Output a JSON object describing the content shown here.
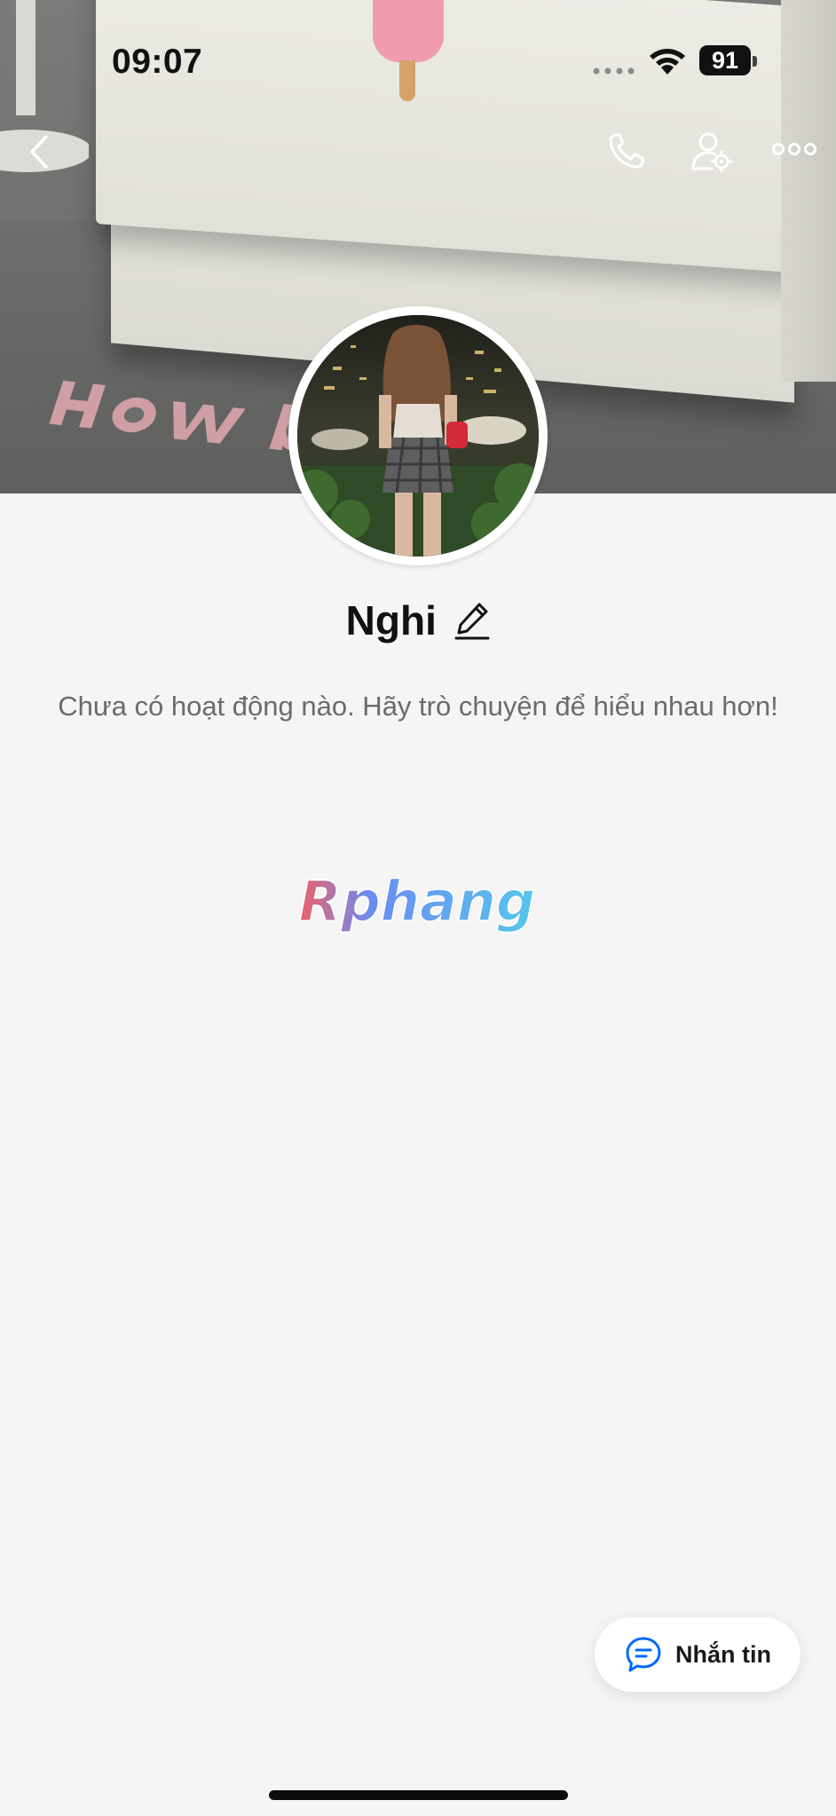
{
  "status_bar": {
    "time": "09:07",
    "battery": "91"
  },
  "profile": {
    "name": "Nghi",
    "empty_message": "Chưa có hoạt động nào. Hãy trò chuyện để hiểu nhau hơn!"
  },
  "watermark": {
    "text": "Rphang"
  },
  "actions": {
    "message_label": "Nhắn tin"
  },
  "icons": {
    "back": "chevron-left-icon",
    "call": "phone-icon",
    "profile_settings": "user-gear-icon",
    "more": "more-horizontal-icon",
    "edit": "pencil-icon",
    "message": "chat-bubble-icon"
  },
  "colors": {
    "accent": "#0068ff",
    "background": "#f5f5f5"
  }
}
